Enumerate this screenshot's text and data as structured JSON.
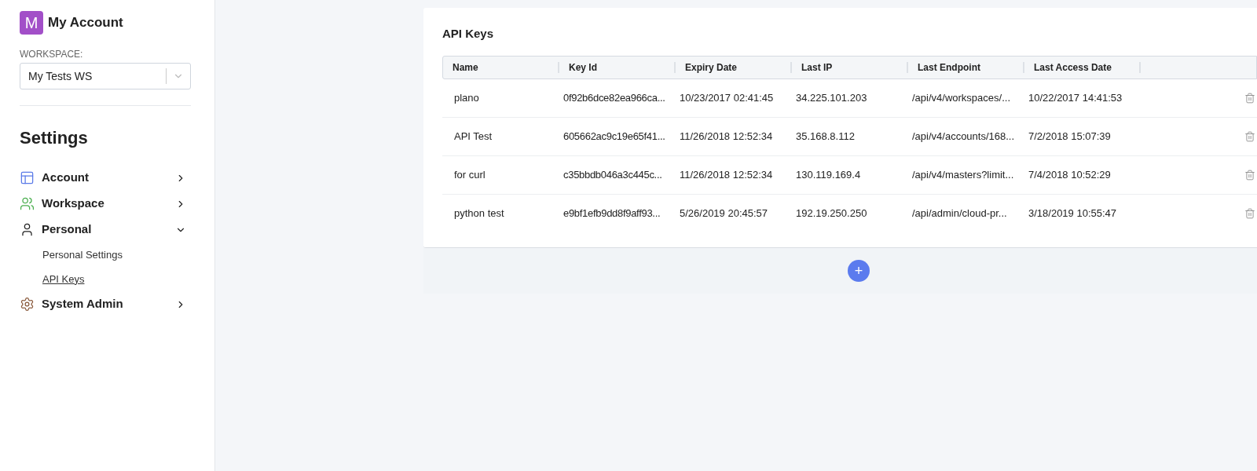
{
  "account": {
    "logo_letter": "M",
    "title": "My Account"
  },
  "workspace": {
    "label": "WORKSPACE:",
    "value": "My Tests WS"
  },
  "settings": {
    "heading": "Settings",
    "items": [
      {
        "label": "Account",
        "expanded": false
      },
      {
        "label": "Workspace",
        "expanded": false
      },
      {
        "label": "Personal",
        "expanded": true,
        "children": [
          {
            "label": "Personal Settings",
            "selected": false
          },
          {
            "label": "API Keys",
            "selected": true
          }
        ]
      },
      {
        "label": "System Admin",
        "expanded": false
      }
    ]
  },
  "api_keys": {
    "title": "API Keys",
    "columns": [
      "Name",
      "Key Id",
      "Expiry Date",
      "Last IP",
      "Last Endpoint",
      "Last Access Date"
    ],
    "rows": [
      [
        "plano",
        "0f92b6dce82ea966ca...",
        "10/23/2017 02:41:45",
        "34.225.101.203",
        "/api/v4/workspaces/...",
        "10/22/2017 14:41:53"
      ],
      [
        "API Test",
        "605662ac9c19e65f41...",
        "11/26/2018 12:52:34",
        "35.168.8.112",
        "/api/v4/accounts/168...",
        "7/2/2018 15:07:39"
      ],
      [
        "for curl",
        "c35bbdb046a3c445c...",
        "11/26/2018 12:52:34",
        "130.119.169.4",
        "/api/v4/masters?limit...",
        "7/4/2018 10:52:29"
      ],
      [
        "python test",
        "e9bf1efb9dd8f9aff93...",
        "5/26/2019 20:45:57",
        "192.19.250.250",
        "/api/admin/cloud-pr...",
        "3/18/2019 10:55:47"
      ]
    ],
    "add_button": "+"
  }
}
